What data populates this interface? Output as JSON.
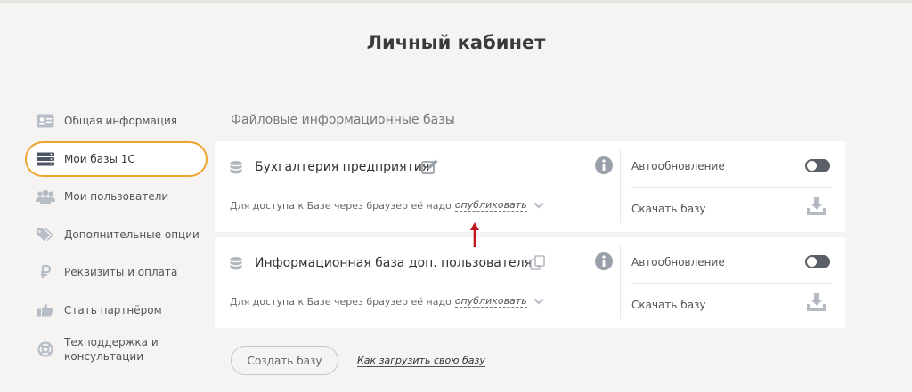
{
  "page_title": "Личный кабинет",
  "sidebar": {
    "items": [
      {
        "label": "Общая информация",
        "icon": "id-card-icon"
      },
      {
        "label": "Мои базы 1С",
        "icon": "server-icon",
        "active": true
      },
      {
        "label": "Мои пользователи",
        "icon": "users-icon"
      },
      {
        "label": "Дополнительные опции",
        "icon": "tags-icon"
      },
      {
        "label": "Реквизиты и оплата",
        "icon": "ruble-icon"
      },
      {
        "label": "Стать партнёром",
        "icon": "thumbs-up-icon"
      },
      {
        "label_line1": "Техподдержка и",
        "label_line2": "консультации",
        "icon": "lifebuoy-icon"
      }
    ]
  },
  "section_title": "Файловые информационные базы",
  "databases": [
    {
      "name": "Бухгалтерия предприятия",
      "name_icon": "edit-icon",
      "access_text": "Для доступа к Базе через браузер её надо",
      "publish_link": "опубликовать",
      "autoupdate_label": "Автообновление",
      "download_label": "Скачать базу"
    },
    {
      "name": "Информационная база доп. пользователя 5",
      "name_icon": "copy-icon",
      "access_text": "Для доступа к Базе через браузер её надо",
      "publish_link": "опубликовать",
      "autoupdate_label": "Автообновление",
      "download_label": "Скачать базу"
    }
  ],
  "create_button": "Создать базу",
  "upload_link": "Как загрузить свою базу",
  "colors": {
    "accent": "#f0a430",
    "annotation_arrow": "#c0161b",
    "toggle": "#5a5f68",
    "background": "#f5f4f2"
  }
}
